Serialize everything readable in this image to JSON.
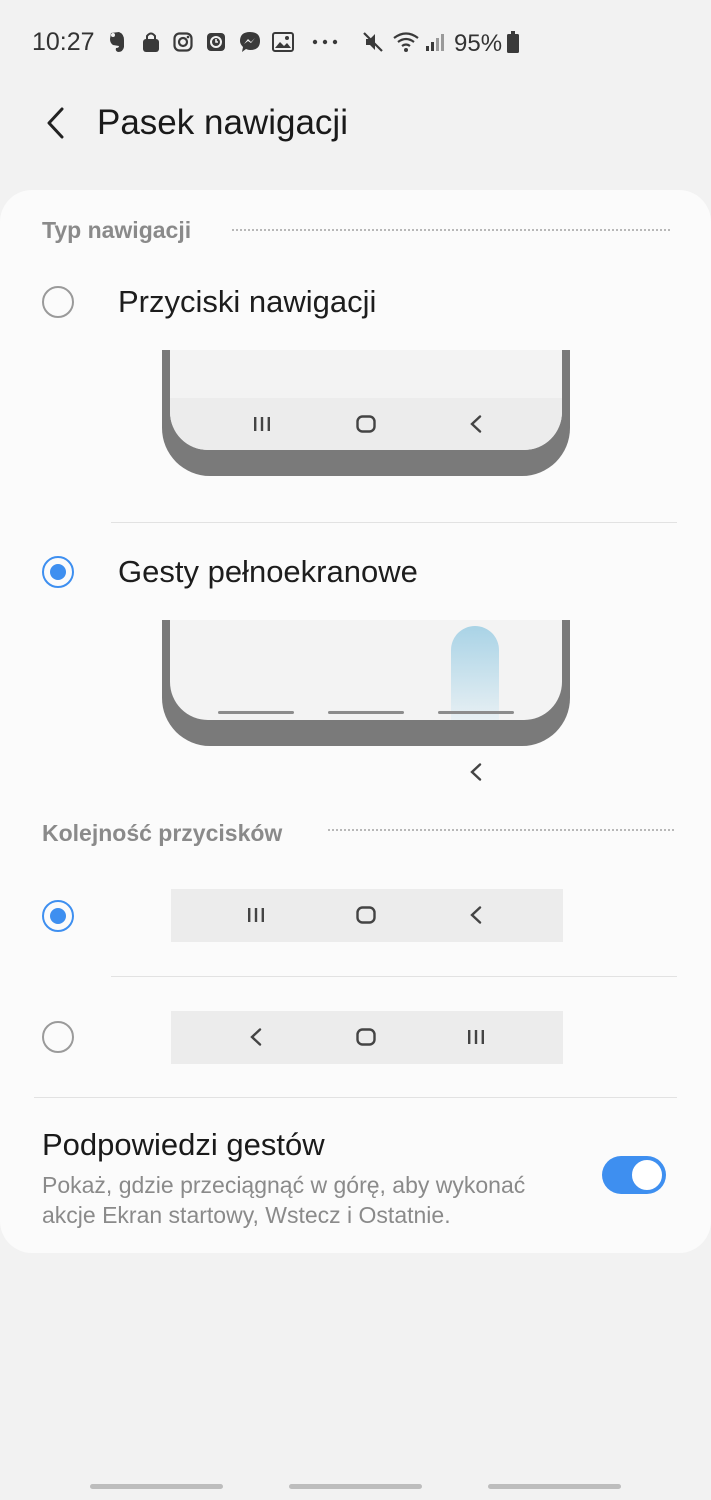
{
  "status_bar": {
    "time": "10:27",
    "battery": "95%",
    "notification_icons": [
      "evernote-icon",
      "shopping-bag-icon",
      "instagram-icon",
      "clock-app-icon",
      "messenger-icon",
      "gallery-icon",
      "more-dots-icon"
    ],
    "system_icons": [
      "mute-icon",
      "wifi-icon",
      "signal-icon",
      "battery-icon"
    ]
  },
  "header": {
    "title": "Pasek nawigacji",
    "back_icon": "chevron-left-icon"
  },
  "navigation_type": {
    "section_title": "Typ nawigacji",
    "options": [
      {
        "label": "Przyciski nawigacji",
        "selected": false
      },
      {
        "label": "Gesty pełnoekranowe",
        "selected": true
      }
    ]
  },
  "button_order": {
    "section_title": "Kolejność przycisków",
    "options": [
      {
        "order": [
          "recents-icon",
          "home-icon",
          "back-icon"
        ],
        "selected": true
      },
      {
        "order": [
          "back-icon",
          "home-icon",
          "recents-icon"
        ],
        "selected": false
      }
    ]
  },
  "gesture_hints": {
    "title": "Podpowiedzi gestów",
    "description": "Pokaż, gdzie przeciągnąć w górę, aby wykonać akcje Ekran startowy, Wstecz i Ostatnie.",
    "enabled": true
  },
  "colors": {
    "accent": "#3e8ff0",
    "background": "#f2f2f2",
    "card": "#fbfbfb"
  }
}
